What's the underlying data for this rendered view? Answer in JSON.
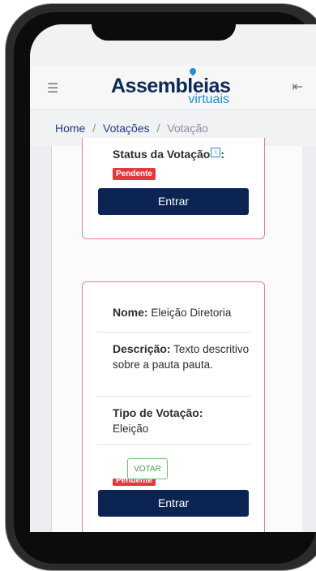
{
  "header": {
    "menu_icon": "hamburger-icon",
    "logo_main": "Assembleias",
    "logo_sub": "virtuais",
    "logout_icon": "logout-icon"
  },
  "breadcrumb": {
    "home": "Home",
    "separator": "/",
    "votacoes": "Votações",
    "current": "Votação"
  },
  "card1": {
    "status_label": "Status da Votação",
    "status_colon": ":",
    "info_icon_text": "i",
    "status_badge": "Pendente",
    "enter_button": "Entrar"
  },
  "card2": {
    "nome_label": "Nome:",
    "nome_value": "Eleição Diretoria",
    "descricao_label": "Descrição:",
    "descricao_value": "Texto descritivo sobre a pauta pauta.",
    "tipo_label": "Tipo de Votação:",
    "tipo_value": "Eleição",
    "votar_button": "VOTAR",
    "status_badge": "Pendente",
    "enter_button": "Entrar"
  },
  "colors": {
    "navy": "#0b2451",
    "accent_blue": "#1f8fce",
    "danger": "#e2383f",
    "card_border": "#e28080",
    "success": "#4aa04f"
  }
}
